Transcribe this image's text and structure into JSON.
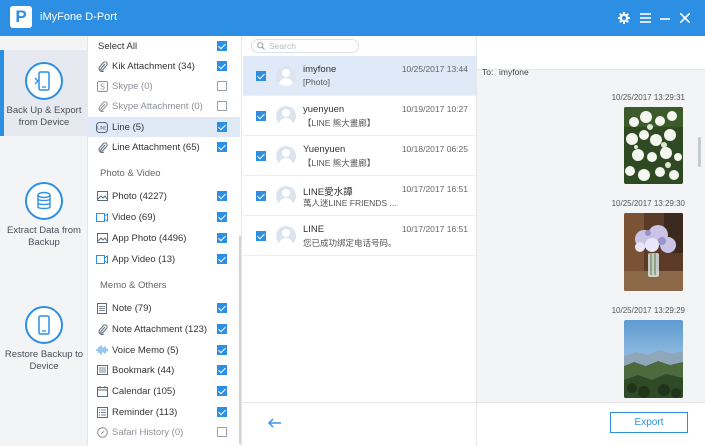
{
  "app": {
    "title": "iMyFone D-Port",
    "logo_letter": "P"
  },
  "sidebar": {
    "items": [
      {
        "label": "Back Up & Export from Device",
        "icon": "phone-export-icon",
        "active": true
      },
      {
        "label": "Extract Data from Backup",
        "icon": "database-icon",
        "active": false
      },
      {
        "label": "Restore Backup to Device",
        "icon": "phone-restore-icon",
        "active": false
      }
    ]
  },
  "categories": {
    "select_all": "Select All",
    "items": [
      {
        "label": "Kik Attachment (34)",
        "icon": "paperclip-icon",
        "checked": true,
        "dim": false
      },
      {
        "label": "Skype (0)",
        "icon": "skype-icon",
        "checked": false,
        "dim": true
      },
      {
        "label": "Skype Attachment (0)",
        "icon": "paperclip-icon",
        "checked": false,
        "dim": true
      },
      {
        "label": "Line (5)",
        "icon": "line-icon",
        "checked": true,
        "dim": false,
        "selected": true
      },
      {
        "label": "Line Attachment (65)",
        "icon": "paperclip-icon",
        "checked": true,
        "dim": false
      }
    ],
    "photo_section": "Photo & Video",
    "photo_items": [
      {
        "label": "Photo (4227)",
        "icon": "image-icon",
        "checked": true
      },
      {
        "label": "Video (69)",
        "icon": "video-icon",
        "checked": true
      },
      {
        "label": "App Photo (4496)",
        "icon": "image-icon",
        "checked": true
      },
      {
        "label": "App Video (13)",
        "icon": "video-icon",
        "checked": true
      }
    ],
    "memo_section": "Memo & Others",
    "memo_items": [
      {
        "label": "Note (79)",
        "icon": "note-icon",
        "checked": true,
        "dim": false
      },
      {
        "label": "Note Attachment (123)",
        "icon": "paperclip-icon",
        "checked": true,
        "dim": false
      },
      {
        "label": "Voice Memo (5)",
        "icon": "waveform-icon",
        "checked": true,
        "dim": false
      },
      {
        "label": "Bookmark (44)",
        "icon": "bookmark-icon",
        "checked": true,
        "dim": false
      },
      {
        "label": "Calendar (105)",
        "icon": "calendar-icon",
        "checked": true,
        "dim": false
      },
      {
        "label": "Reminder (113)",
        "icon": "reminder-icon",
        "checked": true,
        "dim": false
      },
      {
        "label": "Safari History (0)",
        "icon": "compass-icon",
        "checked": false,
        "dim": true
      }
    ]
  },
  "search": {
    "placeholder": "Search"
  },
  "messages": [
    {
      "name": "imyfone",
      "preview": "[Photo]",
      "date": "10/25/2017 13:44",
      "checked": true,
      "selected": true
    },
    {
      "name": "yuenyuen",
      "preview": "【LINE 熊大畫廊】",
      "date": "10/19/2017 10:27",
      "checked": true,
      "selected": false
    },
    {
      "name": "Yuenyuen",
      "preview": "【LINE 熊大畫廊】",
      "date": "10/18/2017 06:25",
      "checked": true,
      "selected": false
    },
    {
      "name": "LINE愛水譚",
      "preview": "萬人迷LINE FRIENDS ...",
      "date": "10/17/2017 16:51",
      "checked": true,
      "selected": false
    },
    {
      "name": "LINE",
      "preview": "您已成功绑定电话号码。",
      "date": "10/17/2017 16:51",
      "checked": true,
      "selected": false
    }
  ],
  "conversation": {
    "to_label": "To:",
    "to_name": "imyfone",
    "entries": [
      {
        "time": "10/25/2017 13:29:31",
        "photo": "white-flowers"
      },
      {
        "time": "10/25/2017 13:29:30",
        "photo": "hydrangea-vase"
      },
      {
        "time": "10/25/2017 13:29:29",
        "photo": "mountain-landscape"
      }
    ]
  },
  "footer": {
    "export_label": "Export"
  },
  "colors": {
    "accent": "#2d8fe3",
    "selected_bg": "#dfe9f7"
  }
}
